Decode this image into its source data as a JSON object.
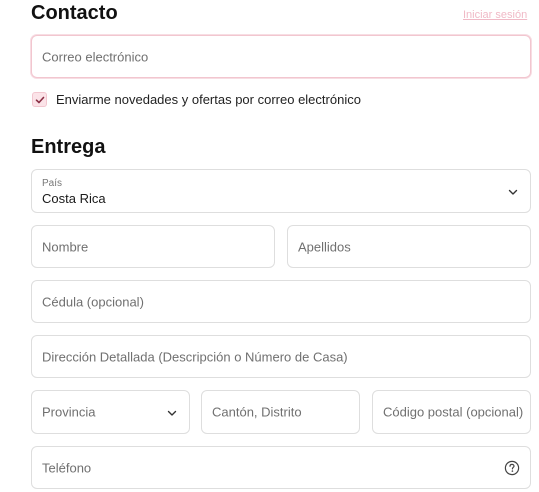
{
  "contact": {
    "heading": "Contacto",
    "login_link": "Iniciar sesión",
    "email_placeholder": "Correo electrónico",
    "newsletter_label": "Enviarme novedades y ofertas por correo electrónico",
    "newsletter_checked": true
  },
  "delivery": {
    "heading": "Entrega",
    "country_label": "País",
    "country_value": "Costa Rica",
    "first_name_placeholder": "Nombre",
    "last_name_placeholder": "Apellidos",
    "id_placeholder": "Cédula (opcional)",
    "address_placeholder": "Dirección Detallada (Descripción o Número de Casa)",
    "province_placeholder": "Provincia",
    "canton_placeholder": "Cantón, Distrito",
    "postal_placeholder": "Código postal (opcional)",
    "phone_placeholder": "Teléfono"
  },
  "colors": {
    "accent": "#f2c6cf",
    "checkbox_fill": "#fbe3e8",
    "link": "#f0b9c6"
  },
  "icons": {
    "checkbox": "check-icon",
    "country_select": "chevron-down-icon",
    "province_select": "chevron-down-icon",
    "phone_help": "help-circle-icon"
  }
}
